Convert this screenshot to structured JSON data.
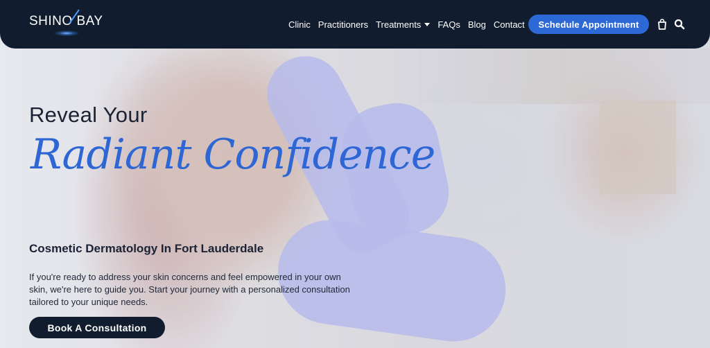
{
  "brand": {
    "logo_text": "SHINO BAY"
  },
  "nav": {
    "items": [
      {
        "label": "Clinic"
      },
      {
        "label": "Practitioners"
      },
      {
        "label": "Treatments",
        "has_dropdown": true
      },
      {
        "label": "FAQs"
      },
      {
        "label": "Blog"
      },
      {
        "label": "Contact"
      }
    ],
    "cta_label": "Schedule Appointment",
    "icons": [
      "shopping-bag-icon",
      "search-icon"
    ]
  },
  "hero": {
    "heading_line1": "Reveal Your",
    "heading_line2": "Radiant Confidence",
    "subheading": "Cosmetic Dermatology In Fort Lauderdale",
    "body": "If you're ready to address your skin concerns and feel empowered in your own skin, we're here to guide you. Start your journey with a personalized consultation tailored to your unique needs.",
    "button_label": "Book A Consultation"
  },
  "colors": {
    "header_bg": "#111d2e",
    "accent_blue": "#2c69d6",
    "script_blue": "#2e66d4",
    "text_dark": "#1a2233"
  }
}
